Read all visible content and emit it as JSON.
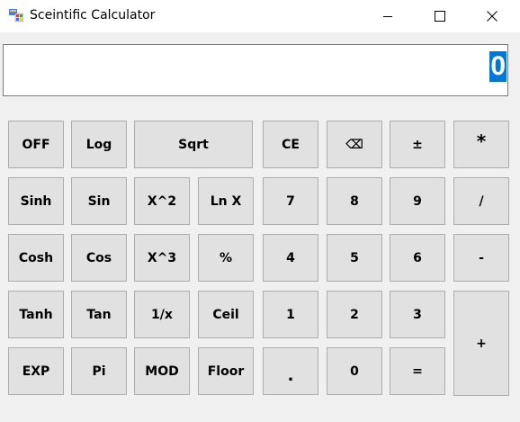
{
  "window": {
    "title": "Sceintific Calculator"
  },
  "display": {
    "value": "0"
  },
  "keys": {
    "off": "OFF",
    "log": "Log",
    "sqrt": "Sqrt",
    "ce": "CE",
    "backspace": "⌫",
    "plus_minus": "±",
    "multiply": "*",
    "sinh": "Sinh",
    "sin": "Sin",
    "x_squared": "X^2",
    "ln_x": "Ln X",
    "seven": "7",
    "eight": "8",
    "nine": "9",
    "divide": "/",
    "cosh": "Cosh",
    "cos": "Cos",
    "x_cubed": "X^3",
    "percent": "%",
    "four": "4",
    "five": "5",
    "six": "6",
    "minus": "-",
    "tanh": "Tanh",
    "tan": "Tan",
    "reciprocal": "1/x",
    "ceil": "Ceil",
    "one": "1",
    "two": "2",
    "three": "3",
    "plus": "+",
    "exp": "EXP",
    "pi": "Pi",
    "mod": "MOD",
    "floor": "Floor",
    "decimal": ".",
    "zero": "0",
    "equals": "="
  },
  "icons": {
    "app": "calculator-app-icon",
    "minimize": "minimize-icon",
    "maximize": "maximize-icon",
    "close": "close-icon"
  },
  "colors": {
    "display_highlight": "#0078d7",
    "key_face": "#e1e1e1",
    "client_background": "#f0f0f0"
  }
}
